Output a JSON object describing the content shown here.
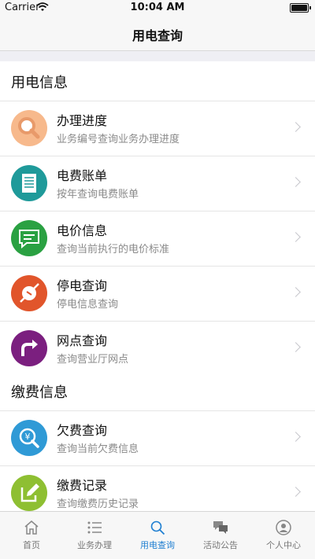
{
  "status_bar": {
    "carrier": "Carrier",
    "time": "10:04 AM"
  },
  "nav": {
    "title": "用电查询"
  },
  "sections": [
    {
      "title": "用电信息",
      "items": [
        {
          "title": "办理进度",
          "subtitle": "业务编号查询业务办理进度",
          "icon": "search-icon",
          "color": "#f7b98c"
        },
        {
          "title": "电费账单",
          "subtitle": "按年查询电费账单",
          "icon": "bill-icon",
          "color": "#1f9a9a"
        },
        {
          "title": "电价信息",
          "subtitle": "查询当前执行的电价标准",
          "icon": "message-icon",
          "color": "#2aa142"
        },
        {
          "title": "停电查询",
          "subtitle": "停电信息查询",
          "icon": "plug-icon",
          "color": "#e1552b"
        },
        {
          "title": "网点查询",
          "subtitle": "查询营业厅网点",
          "icon": "arrow-icon",
          "color": "#7b1f7f"
        }
      ]
    },
    {
      "title": "缴费信息",
      "items": [
        {
          "title": "欠费查询",
          "subtitle": "查询当前欠费信息",
          "icon": "yen-search-icon",
          "color": "#2f9ad6"
        },
        {
          "title": "缴费记录",
          "subtitle": "查询缴费历史记录",
          "icon": "edit-icon",
          "color": "#8ebf32"
        }
      ]
    }
  ],
  "tabs": [
    {
      "label": "首页",
      "icon": "home-icon",
      "active": false
    },
    {
      "label": "业务办理",
      "icon": "list-icon",
      "active": false
    },
    {
      "label": "用电查询",
      "icon": "search-icon",
      "active": true
    },
    {
      "label": "活动公告",
      "icon": "chat-icon",
      "active": false
    },
    {
      "label": "个人中心",
      "icon": "user-icon",
      "active": false
    }
  ],
  "colors": {
    "accent": "#1f7fd1",
    "tab_inactive": "#777777"
  }
}
